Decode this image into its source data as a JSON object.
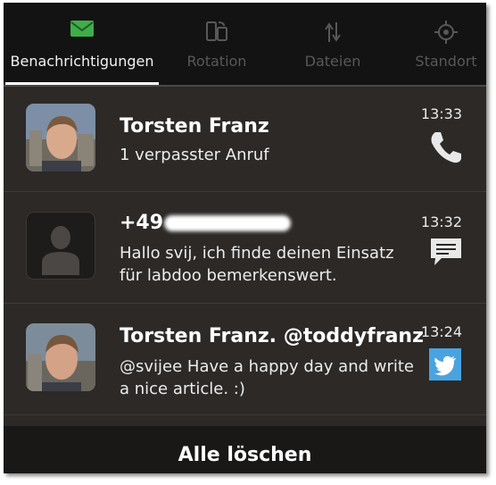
{
  "tabs": [
    {
      "label": "Benachrichtigungen",
      "icon": "envelope-icon",
      "active": true
    },
    {
      "label": "Rotation",
      "icon": "rotation-icon",
      "active": false
    },
    {
      "label": "Dateien",
      "icon": "transfer-icon",
      "active": false
    },
    {
      "label": "Standort",
      "icon": "location-icon",
      "active": false
    }
  ],
  "notifications": [
    {
      "title": "Torsten Franz",
      "body": "1 verpasster Anruf",
      "time": "13:33",
      "icon": "phone-icon",
      "avatar": "contact-photo"
    },
    {
      "title": "+49",
      "body": "Hallo svij, ich finde deinen Einsatz für labdoo bemerkenswert.",
      "time": "13:32",
      "icon": "message-icon",
      "avatar": "placeholder-avatar"
    },
    {
      "title": "Torsten Franz. @toddyfranz",
      "body": "@svijee Have a happy day and write a nice article. :)",
      "time": "13:24",
      "icon": "twitter-icon",
      "avatar": "contact-photo"
    }
  ],
  "clear_all": "Alle löschen",
  "colors": {
    "accent_green": "#3fae49",
    "twitter_blue": "#4aa3df",
    "panel_bg": "#2c2927"
  }
}
